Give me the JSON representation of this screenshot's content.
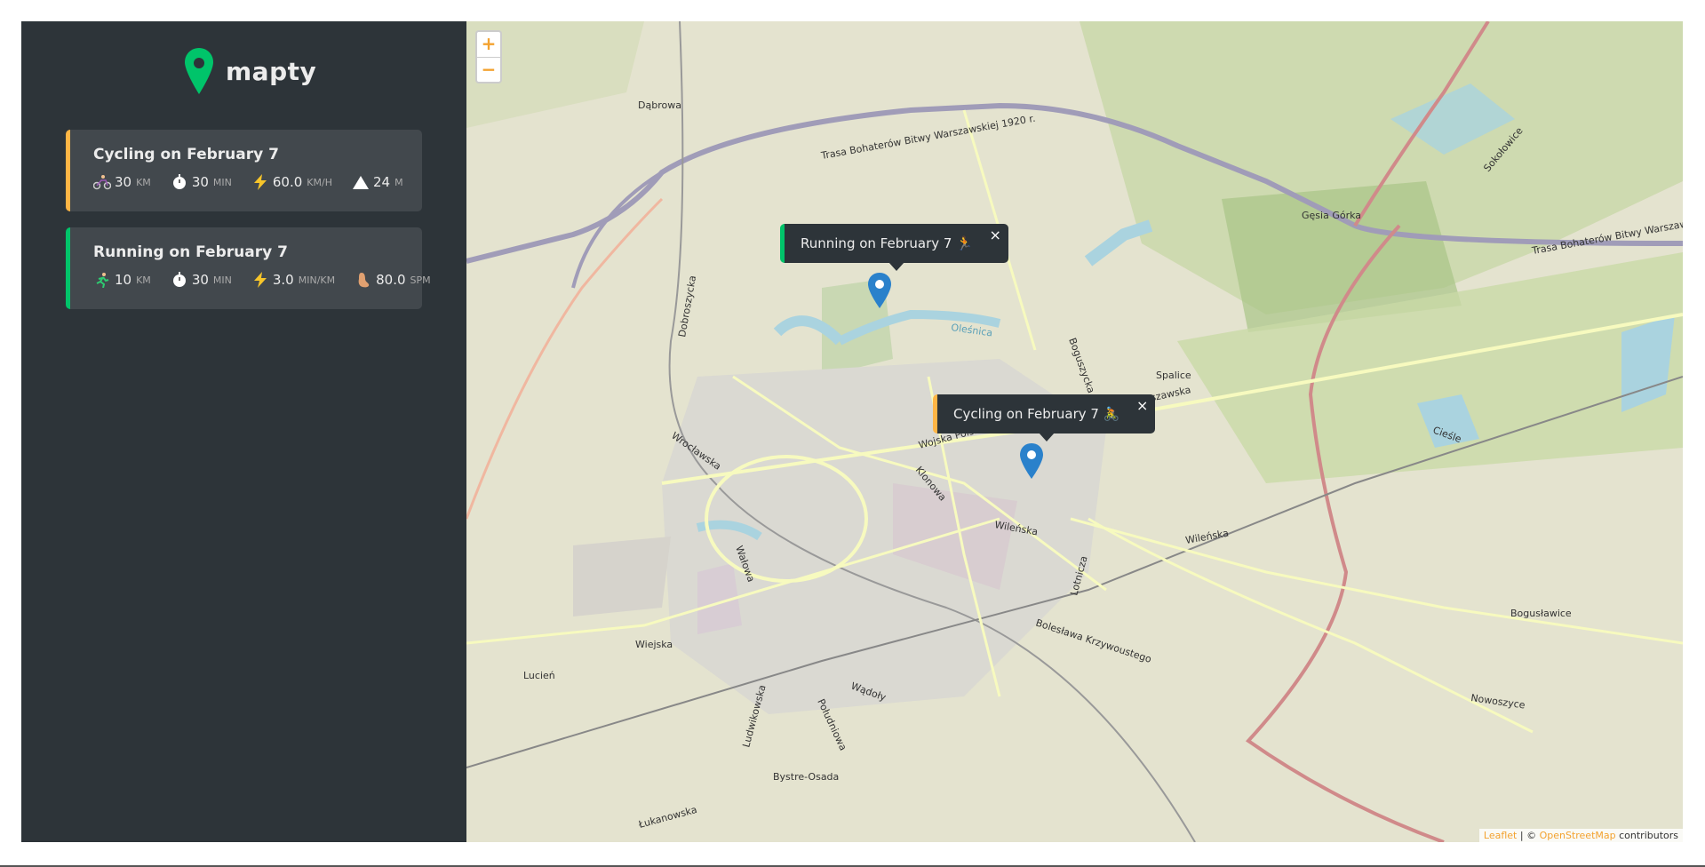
{
  "app": {
    "logo_text": "mapty",
    "brand_color": "#00c46a"
  },
  "workouts": [
    {
      "type": "cycling",
      "title": "Cycling on February 7",
      "accent": "#ffb545",
      "details": [
        {
          "icon": "cyclist-icon",
          "value": "30",
          "unit": "km"
        },
        {
          "icon": "stopwatch-icon",
          "value": "30",
          "unit": "min"
        },
        {
          "icon": "lightning-icon",
          "value": "60.0",
          "unit": "km/h"
        },
        {
          "icon": "mountain-icon",
          "value": "24",
          "unit": "m"
        }
      ]
    },
    {
      "type": "running",
      "title": "Running on February 7",
      "accent": "#00c46a",
      "details": [
        {
          "icon": "runner-icon",
          "value": "10",
          "unit": "km"
        },
        {
          "icon": "stopwatch-icon",
          "value": "30",
          "unit": "min"
        },
        {
          "icon": "lightning-icon",
          "value": "3.0",
          "unit": "min/km"
        },
        {
          "icon": "footprint-icon",
          "value": "80.0",
          "unit": "spm"
        }
      ]
    }
  ],
  "map": {
    "zoom_in": "+",
    "zoom_out": "−",
    "popups": {
      "running": {
        "text": "Running on February 7 🏃",
        "close": "×"
      },
      "cycling": {
        "text": "Cycling on February 7 🚴",
        "close": "×"
      }
    },
    "labels": {
      "trasa": "Trasa Bohaterów Bitwy Warszawskiej 1920 r.",
      "trasa2": "Trasa Bohaterów Bitwy Warszawskiej",
      "olesnica": "Oleśnica",
      "wojska_polskiego": "Wojska Polskiego",
      "wilenska": "Wileńska",
      "wilenska2": "Wileńska",
      "boleslawa": "Bolesława Krzywoustego",
      "wroclawska": "Wrocławska",
      "klonowa": "Klonowa",
      "warszawska": "Warszawska",
      "spalice": "Spalice",
      "gesia_gorka": "Gęsia Górka",
      "dabrowa": "Dąbrowa",
      "boguslawice": "Bogusławice",
      "lucien": "Lucień",
      "bystre_osada": "Bystre-Osada",
      "lukanowska": "Łukanowska",
      "wiejska": "Wiejska",
      "poludniowa": "Południowa",
      "ludwikowska": "Ludwikowska",
      "nowoszyce": "Nowoszyce",
      "ciesle": "Cieśle",
      "lotnicza": "Lotnicza",
      "boguszycka": "Boguszycka",
      "dobroszycka": "Dobroszycka",
      "walowa": "Wałowa",
      "wadoly": "Wądoły",
      "sokolowice": "Sokołowice"
    },
    "attribution": {
      "leaflet": "Leaflet",
      "sep": " | © ",
      "osm": "OpenStreetMap",
      "tail": " contributors"
    }
  }
}
